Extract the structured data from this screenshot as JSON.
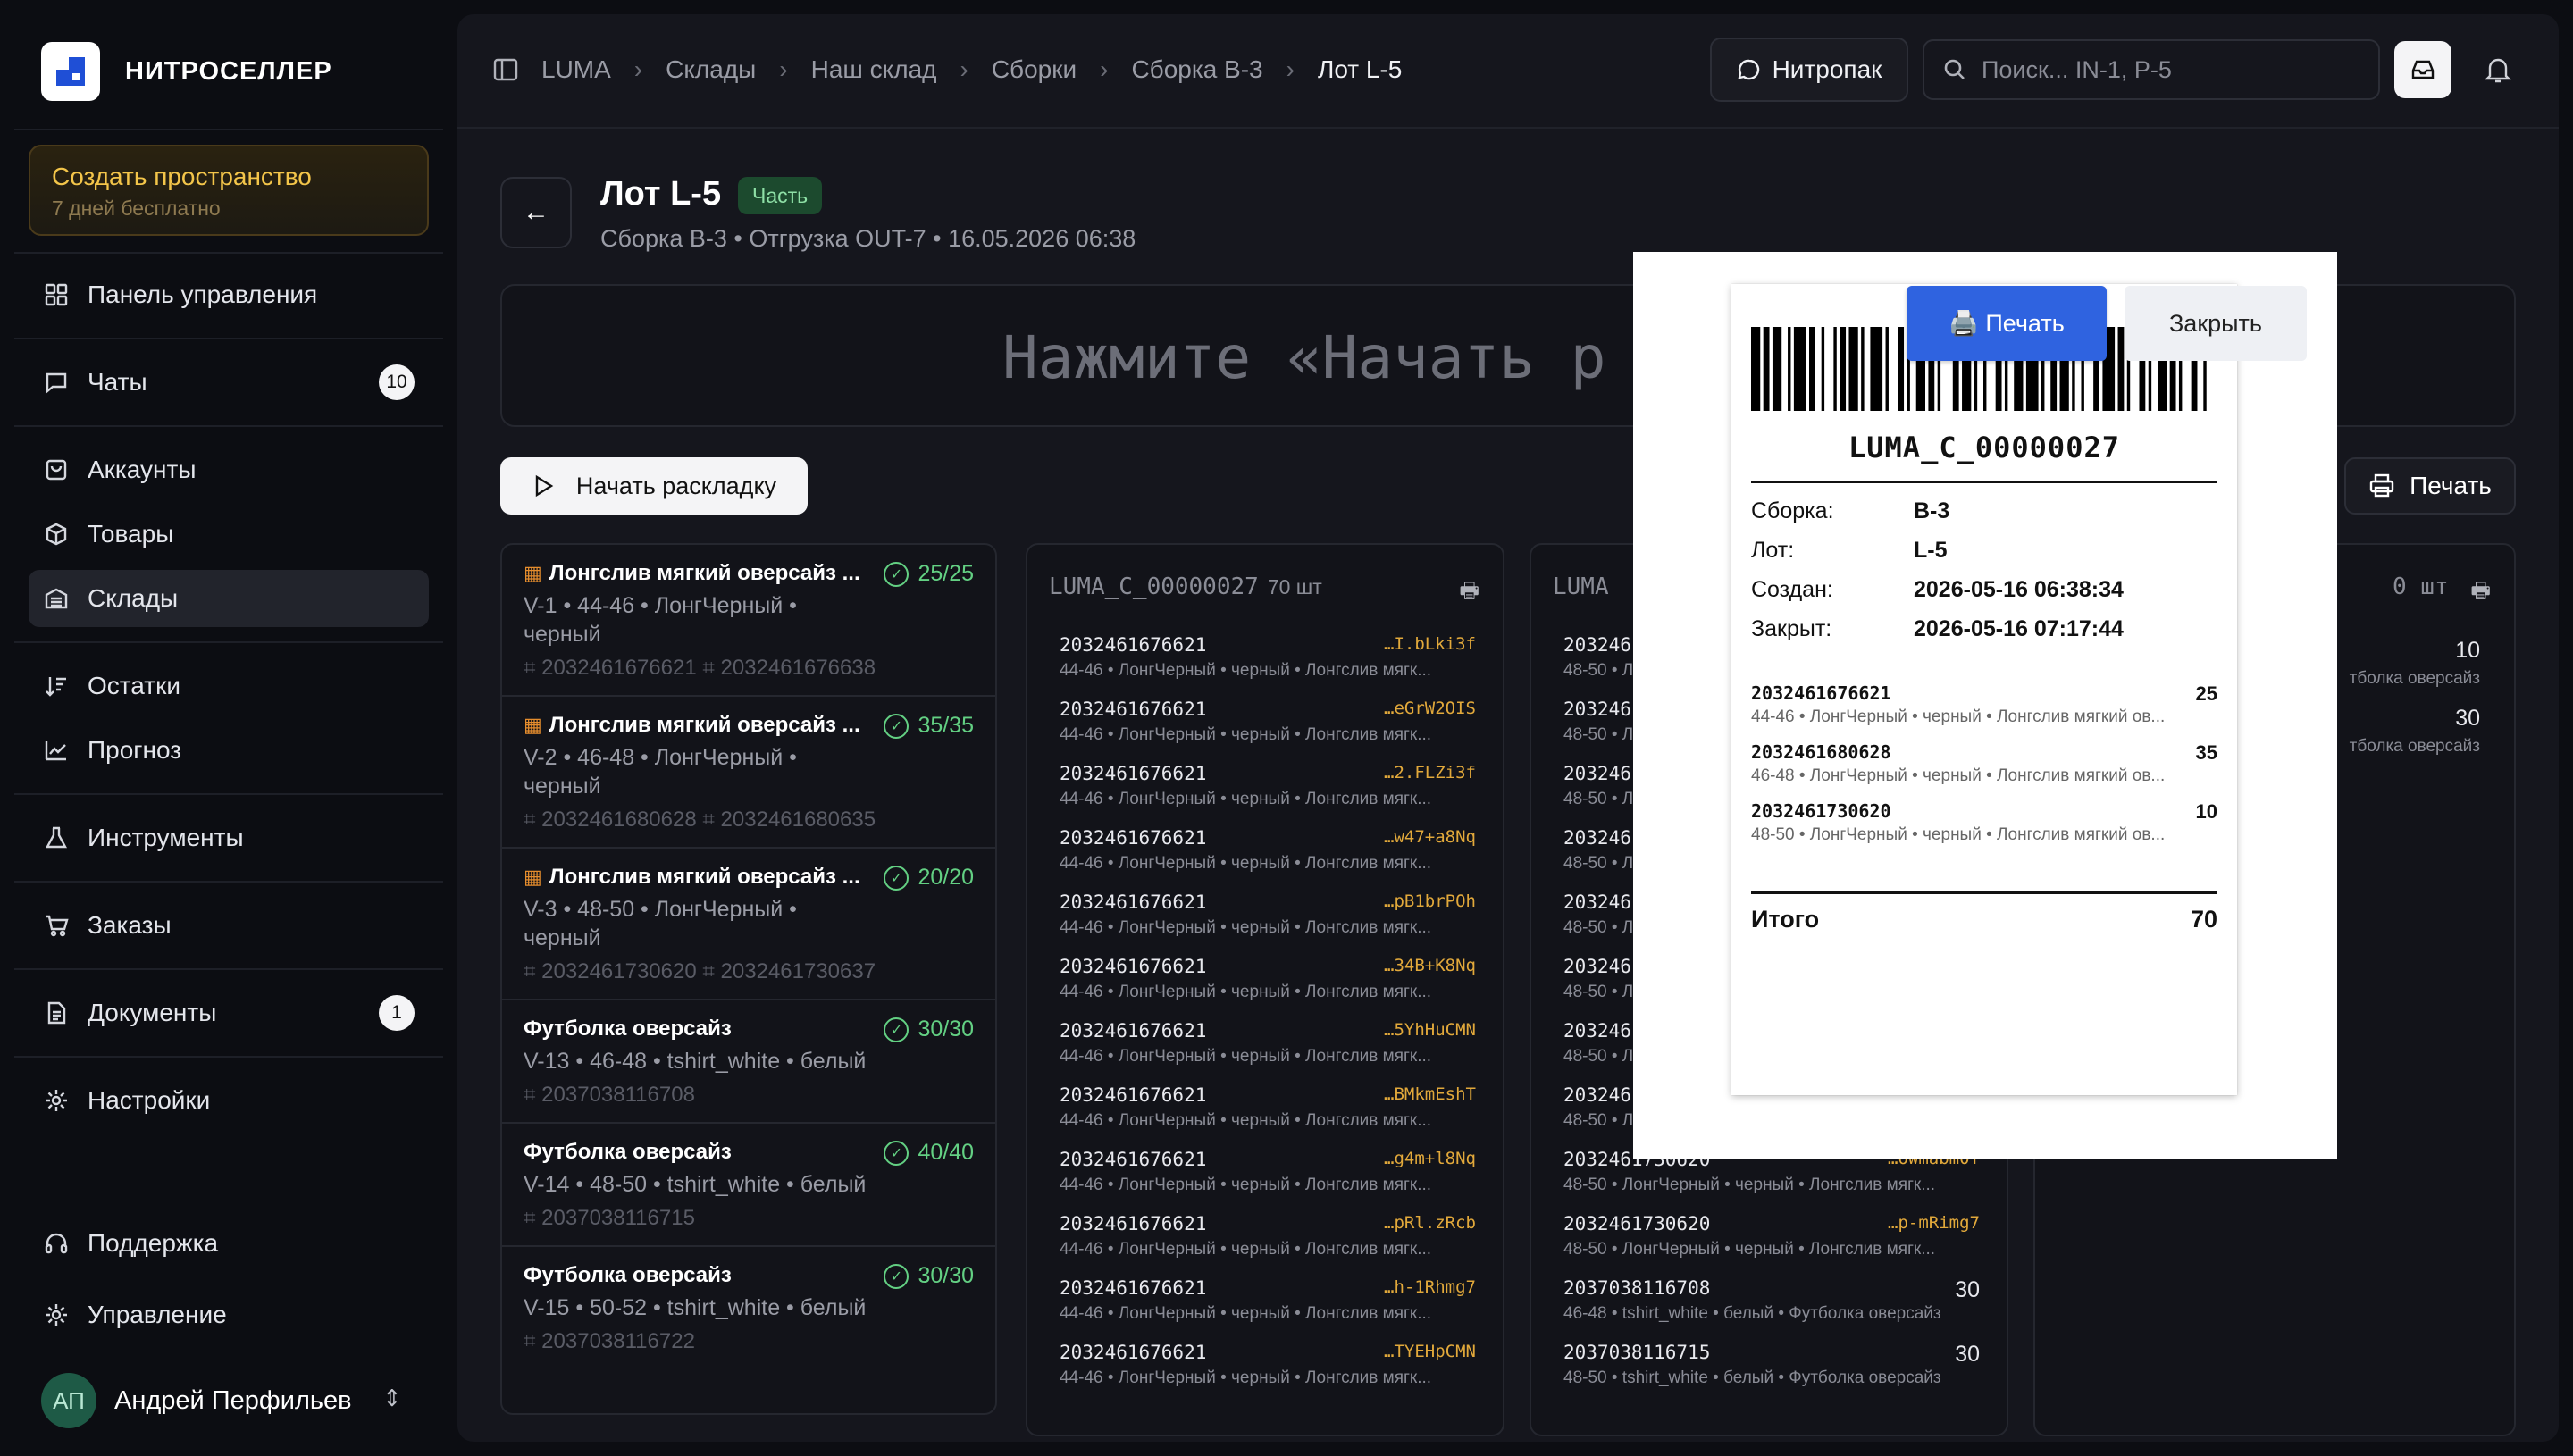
{
  "brand": {
    "name": "НИТРОСЕЛЛЕР"
  },
  "promo": {
    "title": "Создать пространство",
    "subtitle": "7 дней бесплатно"
  },
  "nav": {
    "dashboard": "Панель управления",
    "chats": "Чаты",
    "chats_badge": "10",
    "accounts": "Аккаунты",
    "products": "Товары",
    "warehouses": "Склады",
    "stock": "Остатки",
    "forecast": "Прогноз",
    "tools": "Инструменты",
    "orders": "Заказы",
    "documents": "Документы",
    "documents_badge": "1",
    "settings": "Настройки",
    "support": "Поддержка",
    "management": "Управление"
  },
  "user": {
    "initials": "АП",
    "name": "Андрей Перфильев"
  },
  "breadcrumbs": [
    "LUMA",
    "Склады",
    "Наш склад",
    "Сборки",
    "Сборка B-3",
    "Лот L-5"
  ],
  "header": {
    "nitropak": "Нитропак",
    "search_placeholder": "Поиск... IN-1, P-5"
  },
  "page": {
    "title": "Лот L-5",
    "badge": "Часть",
    "subtitle": "Сборка B-3 • Отгрузка OUT-7 • 16.05.2026 06:38",
    "scan_prompt": "Нажмите «Начать р",
    "start_button": "Начать раскладку",
    "print_button": "Печать"
  },
  "products": [
    {
      "qr": true,
      "name": "Лонгслив мягкий оверсайз ...",
      "count": "25/25",
      "meta": "V-1 • 44-46 • ЛонгЧерный • черный",
      "codes": "⌗ 2032461676621 ⌗ 2032461676638"
    },
    {
      "qr": true,
      "name": "Лонгслив мягкий оверсайз ...",
      "count": "35/35",
      "meta": "V-2 • 46-48 • ЛонгЧерный • черный",
      "codes": "⌗ 2032461680628 ⌗ 2032461680635"
    },
    {
      "qr": true,
      "name": "Лонгслив мягкий оверсайз ...",
      "count": "20/20",
      "meta": "V-3 • 48-50 • ЛонгЧерный • черный",
      "codes": "⌗ 2032461730620 ⌗ 2032461730637"
    },
    {
      "qr": false,
      "name": "Футболка оверсайз",
      "count": "30/30",
      "meta": "V-13 • 46-48 • tshirt_white • белый",
      "codes": "⌗ 2037038116708"
    },
    {
      "qr": false,
      "name": "Футболка оверсайз",
      "count": "40/40",
      "meta": "V-14 • 48-50 • tshirt_white • белый",
      "codes": "⌗ 2037038116715"
    },
    {
      "qr": false,
      "name": "Футболка оверсайз",
      "count": "30/30",
      "meta": "V-15 • 50-52 • tshirt_white • белый",
      "codes": "⌗ 2037038116722"
    }
  ],
  "box1": {
    "title": "LUMA_C_00000027",
    "count": "70 шт",
    "rows": [
      {
        "code": "2032461676621",
        "tail": "…I.bLki3f",
        "desc": "44-46 • ЛонгЧерный • черный • Лонгслив мягк..."
      },
      {
        "code": "2032461676621",
        "tail": "…eGrW2OIS",
        "desc": "44-46 • ЛонгЧерный • черный • Лонгслив мягк..."
      },
      {
        "code": "2032461676621",
        "tail": "…2.FLZi3f",
        "desc": "44-46 • ЛонгЧерный • черный • Лонгслив мягк..."
      },
      {
        "code": "2032461676621",
        "tail": "…w47+a8Nq",
        "desc": "44-46 • ЛонгЧерный • черный • Лонгслив мягк..."
      },
      {
        "code": "2032461676621",
        "tail": "…pB1brPOh",
        "desc": "44-46 • ЛонгЧерный • черный • Лонгслив мягк..."
      },
      {
        "code": "2032461676621",
        "tail": "…34B+K8Nq",
        "desc": "44-46 • ЛонгЧерный • черный • Лонгслив мягк..."
      },
      {
        "code": "2032461676621",
        "tail": "…5YhHuCMN",
        "desc": "44-46 • ЛонгЧерный • черный • Лонгслив мягк..."
      },
      {
        "code": "2032461676621",
        "tail": "…BMkmEshT",
        "desc": "44-46 • ЛонгЧерный • черный • Лонгслив мягк..."
      },
      {
        "code": "2032461676621",
        "tail": "…g4m+l8Nq",
        "desc": "44-46 • ЛонгЧерный • черный • Лонгслив мягк..."
      },
      {
        "code": "2032461676621",
        "tail": "…pRl.zRcb",
        "desc": "44-46 • ЛонгЧерный • черный • Лонгслив мягк..."
      },
      {
        "code": "2032461676621",
        "tail": "…h-1Rhmg7",
        "desc": "44-46 • ЛонгЧерный • черный • Лонгслив мягк..."
      },
      {
        "code": "2032461676621",
        "tail": "…TYEHpCMN",
        "desc": "44-46 • ЛонгЧерный • черный • Лонгслив мягк..."
      }
    ]
  },
  "box2": {
    "title": "LUMA",
    "rows": [
      {
        "code": "203246",
        "desc": "48-50 • Л"
      },
      {
        "code": "203246",
        "desc": "48-50 • Л"
      },
      {
        "code": "203246",
        "desc": "48-50 • Л"
      },
      {
        "code": "203246",
        "desc": "48-50 • Л"
      },
      {
        "code": "203246",
        "desc": "48-50 • Л"
      },
      {
        "code": "203246",
        "desc": "48-50 • Л"
      },
      {
        "code": "203246",
        "desc": "48-50 • Л"
      },
      {
        "code": "203246",
        "desc": "48-50 • Л"
      },
      {
        "code": "2032461730620",
        "tail": "…owmabm0T",
        "desc": "48-50 • ЛонгЧерный • черный • Лонгслив мягк..."
      },
      {
        "code": "2032461730620",
        "tail": "…p-mRimg7",
        "desc": "48-50 • ЛонгЧерный • черный • Лонгслив мягк..."
      },
      {
        "code": "2037038116708",
        "qty": "30",
        "desc": "46-48 • tshirt_white • белый • Футболка оверсайз"
      },
      {
        "code": "2037038116715",
        "qty": "30",
        "desc": "48-50 • tshirt_white • белый • Футболка оверсайз"
      }
    ]
  },
  "box3": {
    "count": "0 шт",
    "rows": [
      {
        "qty": "10",
        "desc": "тболка оверсайз"
      },
      {
        "qty": "30",
        "desc": "тболка оверсайз"
      }
    ]
  },
  "label": {
    "print": "🖨️ Печать",
    "close": "Закрыть",
    "code": "LUMA_C_00000027",
    "fields": [
      {
        "k": "Сборка:",
        "v": "B-3"
      },
      {
        "k": "Лот:",
        "v": "L-5"
      },
      {
        "k": "Создан:",
        "v": "2026-05-16 06:38:34"
      },
      {
        "k": "Закрыт:",
        "v": "2026-05-16 07:17:44"
      }
    ],
    "items": [
      {
        "code": "2032461676621",
        "qty": "25",
        "desc": "44-46 • ЛонгЧерный • черный • Лонгслив мягкий ов..."
      },
      {
        "code": "2032461680628",
        "qty": "35",
        "desc": "46-48 • ЛонгЧерный • черный • Лонгслив мягкий ов..."
      },
      {
        "code": "2032461730620",
        "qty": "10",
        "desc": "48-50 • ЛонгЧерный • черный • Лонгслив мягкий ов..."
      }
    ],
    "total_label": "Итого",
    "total_value": "70"
  }
}
